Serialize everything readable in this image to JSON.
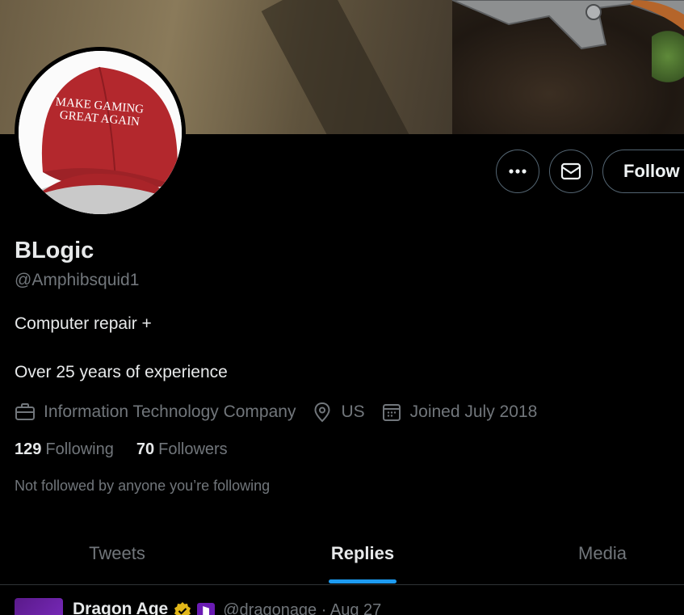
{
  "avatar": {
    "hat_text_line1": "MAKE GAMING",
    "hat_text_line2": "GREAT AGAIN"
  },
  "actions": {
    "more_icon": "more-dots-icon",
    "message_icon": "envelope-icon",
    "follow_label": "Follow"
  },
  "profile": {
    "name": "BLogic",
    "handle": "@Amphibsquid1",
    "bio_line1": "Computer repair +",
    "bio_line2": "Over 25 years of experience",
    "category": "Information Technology Company",
    "location": "US",
    "joined": "Joined July 2018",
    "following_count": "129",
    "following_label": "Following",
    "followers_count": "70",
    "followers_label": "Followers",
    "not_followed_text": "Not followed by anyone you’re following"
  },
  "tabs": [
    {
      "label": "Tweets",
      "active": false
    },
    {
      "label": "Replies",
      "active": true
    },
    {
      "label": "Media",
      "active": false
    }
  ],
  "tweet_preview": {
    "author_name": "Dragon Age",
    "author_handle": "@dragonage · Aug 27"
  },
  "colors": {
    "background": "#000000",
    "accent": "#1d9bf0",
    "secondary_text": "#71767b",
    "verified_gold": "#e2b719"
  }
}
